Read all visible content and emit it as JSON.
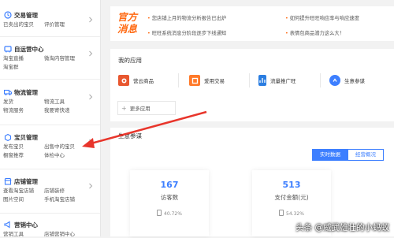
{
  "sidebar": {
    "sections": [
      {
        "title": "交易管理",
        "icon": "trade-icon",
        "links": [
          "已卖出的宝贝",
          "评价管理"
        ]
      },
      {
        "title": "自运营中心",
        "icon": "self-ops-icon",
        "links": [
          "淘宝直播",
          "微淘内容管理",
          "淘宝群"
        ]
      },
      {
        "title": "物流管理",
        "icon": "logistics-icon",
        "links": [
          "发货",
          "物流工具",
          "物流服务",
          "我要寄快递"
        ]
      },
      {
        "title": "宝贝管理",
        "icon": "goods-icon",
        "links": [
          "发布宝贝",
          "出售中的宝贝",
          "橱窗推荐",
          "体检中心"
        ]
      },
      {
        "title": "店铺管理",
        "icon": "shop-icon",
        "links": [
          "查看淘宝店铺",
          "店铺装修",
          "图片空间",
          "手机淘宝店铺"
        ]
      },
      {
        "title": "营销中心",
        "icon": "marketing-icon",
        "links": [
          "营销工具",
          "店铺营销中心"
        ]
      }
    ]
  },
  "banner": {
    "brand": "官方消息",
    "news": [
      "您店铺上月的物流分析报告已出炉",
      "如何提升旺旺响应率与响应速度",
      "旺旺系统消息分阶段逐步下线通知",
      "表情包商品潜力这么大！"
    ]
  },
  "apps": {
    "title": "我的应用",
    "items": [
      {
        "label": "营云商品",
        "color": "#e8572f",
        "icon": "ying-yun-icon"
      },
      {
        "label": "爱用交易",
        "color": "#ff7a2a",
        "icon": "ai-yong-icon"
      },
      {
        "label": "流量推广旺",
        "color": "#2a7de1",
        "icon": "traffic-icon"
      },
      {
        "label": "生意参谋",
        "color": "#3d7fff",
        "icon": "business-advisor-icon"
      }
    ],
    "add_label": "更多应用"
  },
  "biz": {
    "title": "生意参谋",
    "tabs": [
      "实时数据",
      "经营概况"
    ],
    "metrics": [
      {
        "value": "167",
        "label": "访客数",
        "rate": "40.72%"
      },
      {
        "value": "513",
        "label": "支付金额(元)",
        "rate": "54.32%"
      }
    ]
  },
  "watermark": "头条 @威武雄壮的小蚂蚁",
  "colors": {
    "accent": "#ff6a13",
    "brand_blue": "#3d7fff",
    "annotation_arrow": "#e8352b"
  }
}
